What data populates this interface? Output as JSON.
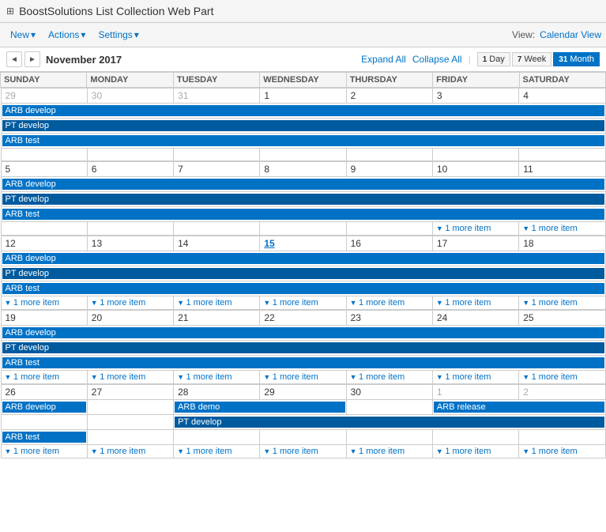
{
  "app": {
    "title": "BoostSolutions List Collection Web Part",
    "icon": "☰"
  },
  "toolbar": {
    "new_label": "New",
    "actions_label": "Actions",
    "settings_label": "Settings",
    "view_label": "View:",
    "view_value": "Calendar View"
  },
  "calendar": {
    "prev_label": "◄",
    "next_label": "►",
    "month_title": "November 2017",
    "expand_all": "Expand All",
    "collapse_all": "Collapse All",
    "day_btn": "Day",
    "week_btn": "Week",
    "month_btn": "Month",
    "day_icon": "1",
    "week_icon": "7",
    "month_icon": "31",
    "headers": [
      "SUNDAY",
      "MONDAY",
      "TUESDAY",
      "WEDNESDAY",
      "THURSDAY",
      "FRIDAY",
      "SATURDAY"
    ],
    "events": {
      "arb_develop": "ARB develop",
      "pt_develop": "PT develop",
      "arb_test": "ARB test",
      "arb_demo": "ARB demo",
      "arb_release": "ARB release"
    },
    "more_item": "1 more item"
  }
}
